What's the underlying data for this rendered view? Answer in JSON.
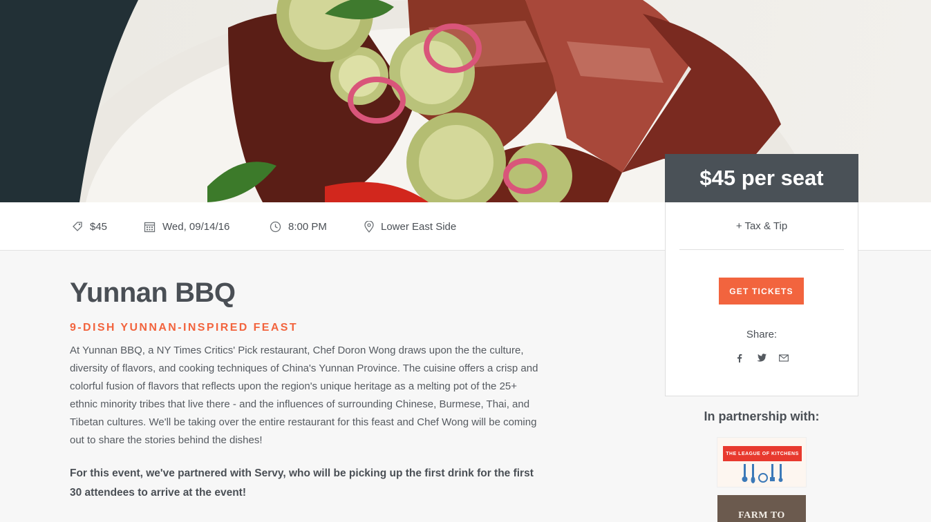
{
  "hero": {
    "image_icon": "bbq-ribs-photo"
  },
  "info": {
    "price": "$45",
    "date": "Wed, 09/14/16",
    "time": "8:00 PM",
    "location": "Lower East Side"
  },
  "event": {
    "title": "Yunnan BBQ",
    "subtitle": "9-DISH YUNNAN-INSPIRED FEAST",
    "description": "At Yunnan BBQ, a NY Times Critics' Pick restaurant, Chef Doron Wong draws upon the the culture, diversity of flavors, and cooking techniques of China's Yunnan Province. The cuisine offers a crisp and colorful fusion of flavors that reflects upon the region's unique heritage as a melting pot of the 25+ ethnic minority tribes that live there - and the influences of surrounding Chinese, Burmese, Thai, and Tibetan cultures. We'll be taking over the entire restaurant for this feast and Chef Wong will be coming out to share the stories behind the dishes!",
    "note": "For this event, we've partnered with Servy, who will be picking up the first drink for the first 30 attendees to arrive at the event!"
  },
  "ticket": {
    "price_label": "$45 per seat",
    "tax_label": "+ Tax & Tip",
    "button_label": "GET TICKETS",
    "share_label": "Share:"
  },
  "partners": {
    "heading": "In partnership with:",
    "partner1_text": "THE LEAGUE OF KITCHENS",
    "partner2_text": "FARM TO PEOPLE"
  },
  "colors": {
    "accent": "#f2643e",
    "dark": "#4a5157",
    "text": "#4a4f55"
  }
}
